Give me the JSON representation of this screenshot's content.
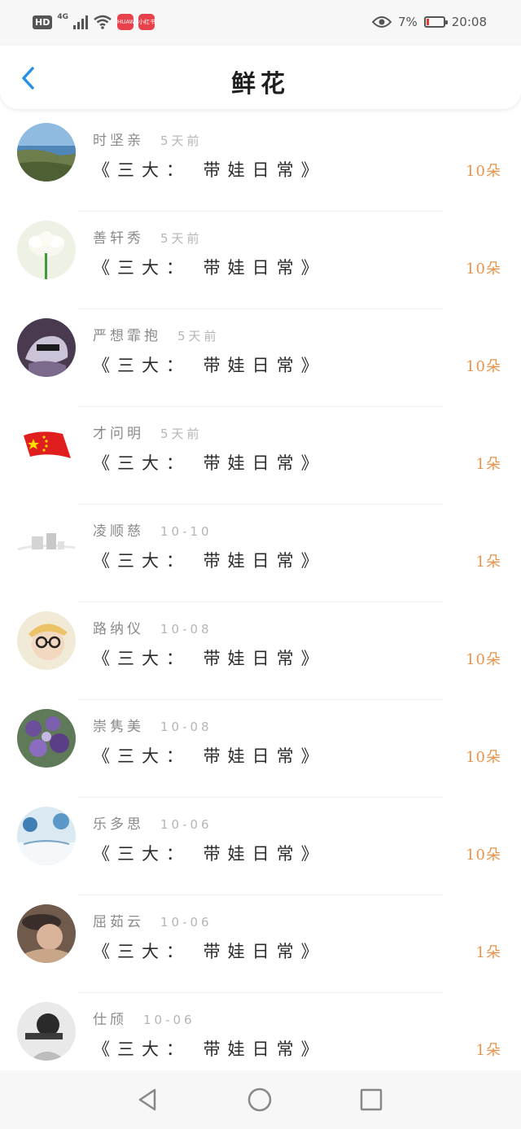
{
  "status_bar": {
    "hd": "HD",
    "network": "4G",
    "app_chip_1": "HUAWEI",
    "app_chip_2": "小红书",
    "battery_percent": "7%",
    "time": "20:08",
    "battery_color": "#e53935"
  },
  "header": {
    "title": "鲜花",
    "back_icon": "chevron-left-icon",
    "accent": "#2b8fe6"
  },
  "gifts": [
    {
      "name": "时坚亲",
      "time": "5天前",
      "title": "《三大： 带娃日常》",
      "count": "10朵",
      "avatar": "coast-landscape"
    },
    {
      "name": "善轩秀",
      "time": "5天前",
      "title": "《三大： 带娃日常》",
      "count": "10朵",
      "avatar": "white-lotus"
    },
    {
      "name": "严想霏抱",
      "time": "5天前",
      "title": "《三大： 带娃日常》",
      "count": "10朵",
      "avatar": "sneaker-photo"
    },
    {
      "name": "才问明",
      "time": "5天前",
      "title": "《三大： 带娃日常》",
      "count": "1朵",
      "avatar": "red-flag"
    },
    {
      "name": "凌顺慈",
      "time": "10-10",
      "title": "《三大： 带娃日常》",
      "count": "1朵",
      "avatar": "faded-sketch"
    },
    {
      "name": "路纳仪",
      "time": "10-08",
      "title": "《三大： 带娃日常》",
      "count": "10朵",
      "avatar": "boy-with-glasses"
    },
    {
      "name": "崇隽美",
      "time": "10-08",
      "title": "《三大： 带娃日常》",
      "count": "10朵",
      "avatar": "purple-flowers"
    },
    {
      "name": "乐多思",
      "time": "10-06",
      "title": "《三大： 带娃日常》",
      "count": "10朵",
      "avatar": "snowy-scene"
    },
    {
      "name": "屈茹云",
      "time": "10-06",
      "title": "《三大： 带娃日常》",
      "count": "1朵",
      "avatar": "girl-with-hat"
    },
    {
      "name": "仕颀",
      "time": "10-06",
      "title": "《三大： 带娃日常》",
      "count": "1朵",
      "avatar": "bw-portrait"
    }
  ],
  "count_color": "#e8944c",
  "nav": {
    "back_icon": "triangle-back-icon",
    "home_icon": "circle-home-icon",
    "recent_icon": "square-recent-icon"
  }
}
